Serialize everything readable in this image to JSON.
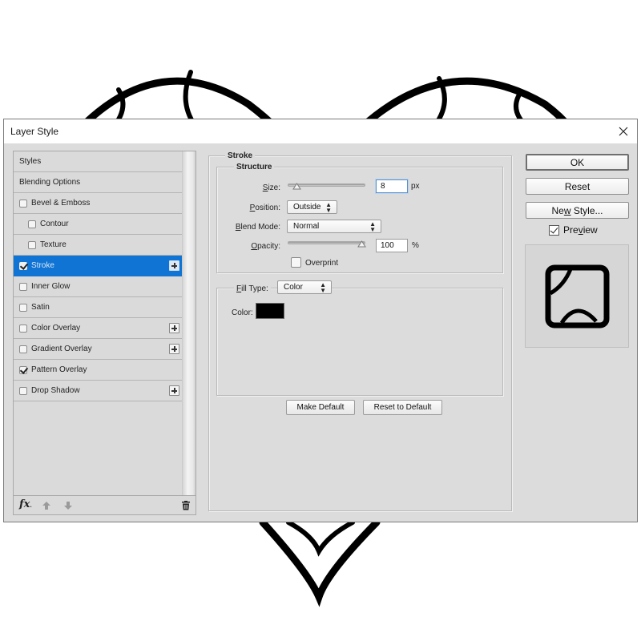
{
  "background": {
    "artwork": "heart-outline",
    "stroke_color": "#000000"
  },
  "dialog": {
    "title": "Layer Style",
    "close_icon": "close-icon"
  },
  "style_list": {
    "items": [
      {
        "label": "Styles",
        "has_checkbox": false,
        "checked": false,
        "indent": false,
        "selected": false,
        "has_add": false
      },
      {
        "label": "Blending Options",
        "has_checkbox": false,
        "checked": false,
        "indent": false,
        "selected": false,
        "has_add": false
      },
      {
        "label": "Bevel & Emboss",
        "has_checkbox": true,
        "checked": false,
        "indent": false,
        "selected": false,
        "has_add": false
      },
      {
        "label": "Contour",
        "has_checkbox": true,
        "checked": false,
        "indent": true,
        "selected": false,
        "has_add": false
      },
      {
        "label": "Texture",
        "has_checkbox": true,
        "checked": false,
        "indent": true,
        "selected": false,
        "has_add": false
      },
      {
        "label": "Stroke",
        "has_checkbox": true,
        "checked": true,
        "indent": false,
        "selected": true,
        "has_add": true
      },
      {
        "label": "Inner Glow",
        "has_checkbox": true,
        "checked": false,
        "indent": false,
        "selected": false,
        "has_add": false
      },
      {
        "label": "Satin",
        "has_checkbox": true,
        "checked": false,
        "indent": false,
        "selected": false,
        "has_add": false
      },
      {
        "label": "Color Overlay",
        "has_checkbox": true,
        "checked": false,
        "indent": false,
        "selected": false,
        "has_add": true
      },
      {
        "label": "Gradient Overlay",
        "has_checkbox": true,
        "checked": false,
        "indent": false,
        "selected": false,
        "has_add": true
      },
      {
        "label": "Pattern Overlay",
        "has_checkbox": true,
        "checked": true,
        "indent": false,
        "selected": false,
        "has_add": false
      },
      {
        "label": "Drop Shadow",
        "has_checkbox": true,
        "checked": false,
        "indent": false,
        "selected": false,
        "has_add": true
      }
    ],
    "footer": {
      "fx_label": "fx",
      "icons": [
        "fx-menu-icon",
        "move-up-icon",
        "move-down-icon",
        "trash-icon"
      ]
    },
    "selected_color": "#0f74d4"
  },
  "stroke": {
    "section_title": "Stroke",
    "structure_title": "Structure",
    "size": {
      "label_prefix": "",
      "label_u": "S",
      "label_rest": "ize:",
      "value": "8",
      "unit": "px",
      "slider_fraction": 0.03
    },
    "position": {
      "label_u": "P",
      "label_rest": "osition:",
      "value": "Outside"
    },
    "blend_mode": {
      "label_u": "B",
      "label_rest": "lend Mode:",
      "value": "Normal"
    },
    "opacity": {
      "label_u": "O",
      "label_rest": "pacity:",
      "value": "100",
      "unit": "%",
      "slider_fraction": 1.0
    },
    "overprint": {
      "label": "Overprint",
      "checked": false
    },
    "fill_type": {
      "label_u": "F",
      "label_rest": "ill Type:",
      "value": "Color"
    },
    "color": {
      "label": "Color:",
      "value": "#000000"
    },
    "make_default_label": "Make Default",
    "reset_default_label": "Reset to Default"
  },
  "actions": {
    "ok_label": "OK",
    "reset_label": "Reset",
    "new_style_pre": "Ne",
    "new_style_u": "w",
    "new_style_post": " Style...",
    "preview_pre": "Pre",
    "preview_u": "v",
    "preview_post": "iew",
    "preview_checked": true
  }
}
